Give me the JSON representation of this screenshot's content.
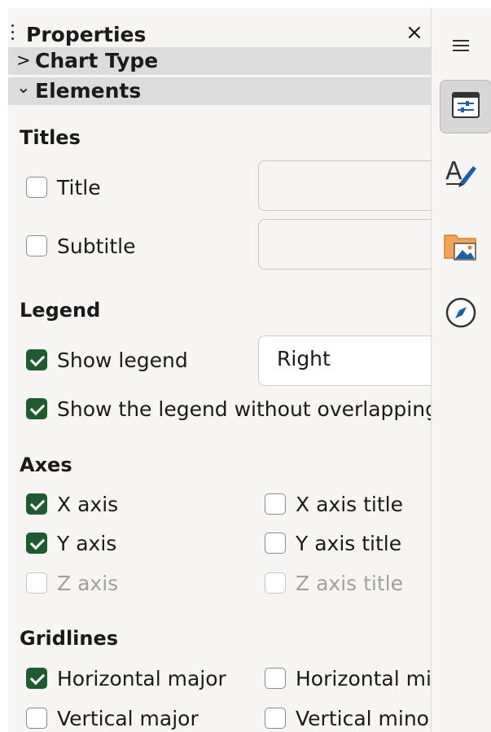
{
  "header": {
    "title": "Properties",
    "close_label": "×"
  },
  "sections": {
    "chart_type": {
      "chevron": ">",
      "label": "Chart Type"
    },
    "elements": {
      "chevron": "⌄",
      "label": "Elements"
    }
  },
  "titles": {
    "heading": "Titles",
    "title": {
      "label": "Title",
      "checked": false,
      "value": ""
    },
    "subtitle": {
      "label": "Subtitle",
      "checked": false,
      "value": ""
    }
  },
  "legend": {
    "heading": "Legend",
    "show_legend": {
      "label": "Show legend",
      "checked": true
    },
    "position": "Right",
    "no_overlap": {
      "label": "Show the legend without overlapping the chart",
      "checked": true
    }
  },
  "axes": {
    "heading": "Axes",
    "x_axis": {
      "label": "X axis",
      "checked": true
    },
    "x_axis_title": {
      "label": "X axis title",
      "checked": false
    },
    "y_axis": {
      "label": "Y axis",
      "checked": true
    },
    "y_axis_title": {
      "label": "Y axis title",
      "checked": false
    },
    "z_axis": {
      "label": "Z axis",
      "checked": false,
      "disabled": true
    },
    "z_axis_title": {
      "label": "Z axis title",
      "checked": false,
      "disabled": true
    }
  },
  "gridlines": {
    "heading": "Gridlines",
    "horizontal_major": {
      "label": "Horizontal major",
      "checked": true
    },
    "horizontal_minor": {
      "label": "Horizontal minor",
      "checked": false
    },
    "vertical_major": {
      "label": "Vertical major",
      "checked": false
    },
    "vertical_minor": {
      "label": "Vertical minor",
      "checked": false
    }
  },
  "tabbar": {
    "menu_icon": "hamburger-menu-icon",
    "tabs": [
      {
        "icon": "properties-icon",
        "active": true
      },
      {
        "icon": "styles-icon",
        "active": false
      },
      {
        "icon": "gallery-icon",
        "active": false
      },
      {
        "icon": "navigator-icon",
        "active": false
      }
    ]
  },
  "colors": {
    "check_accent": "#1f5b30",
    "section_bg": "#dcdcdc",
    "panel_bg": "#f6f5f4"
  }
}
